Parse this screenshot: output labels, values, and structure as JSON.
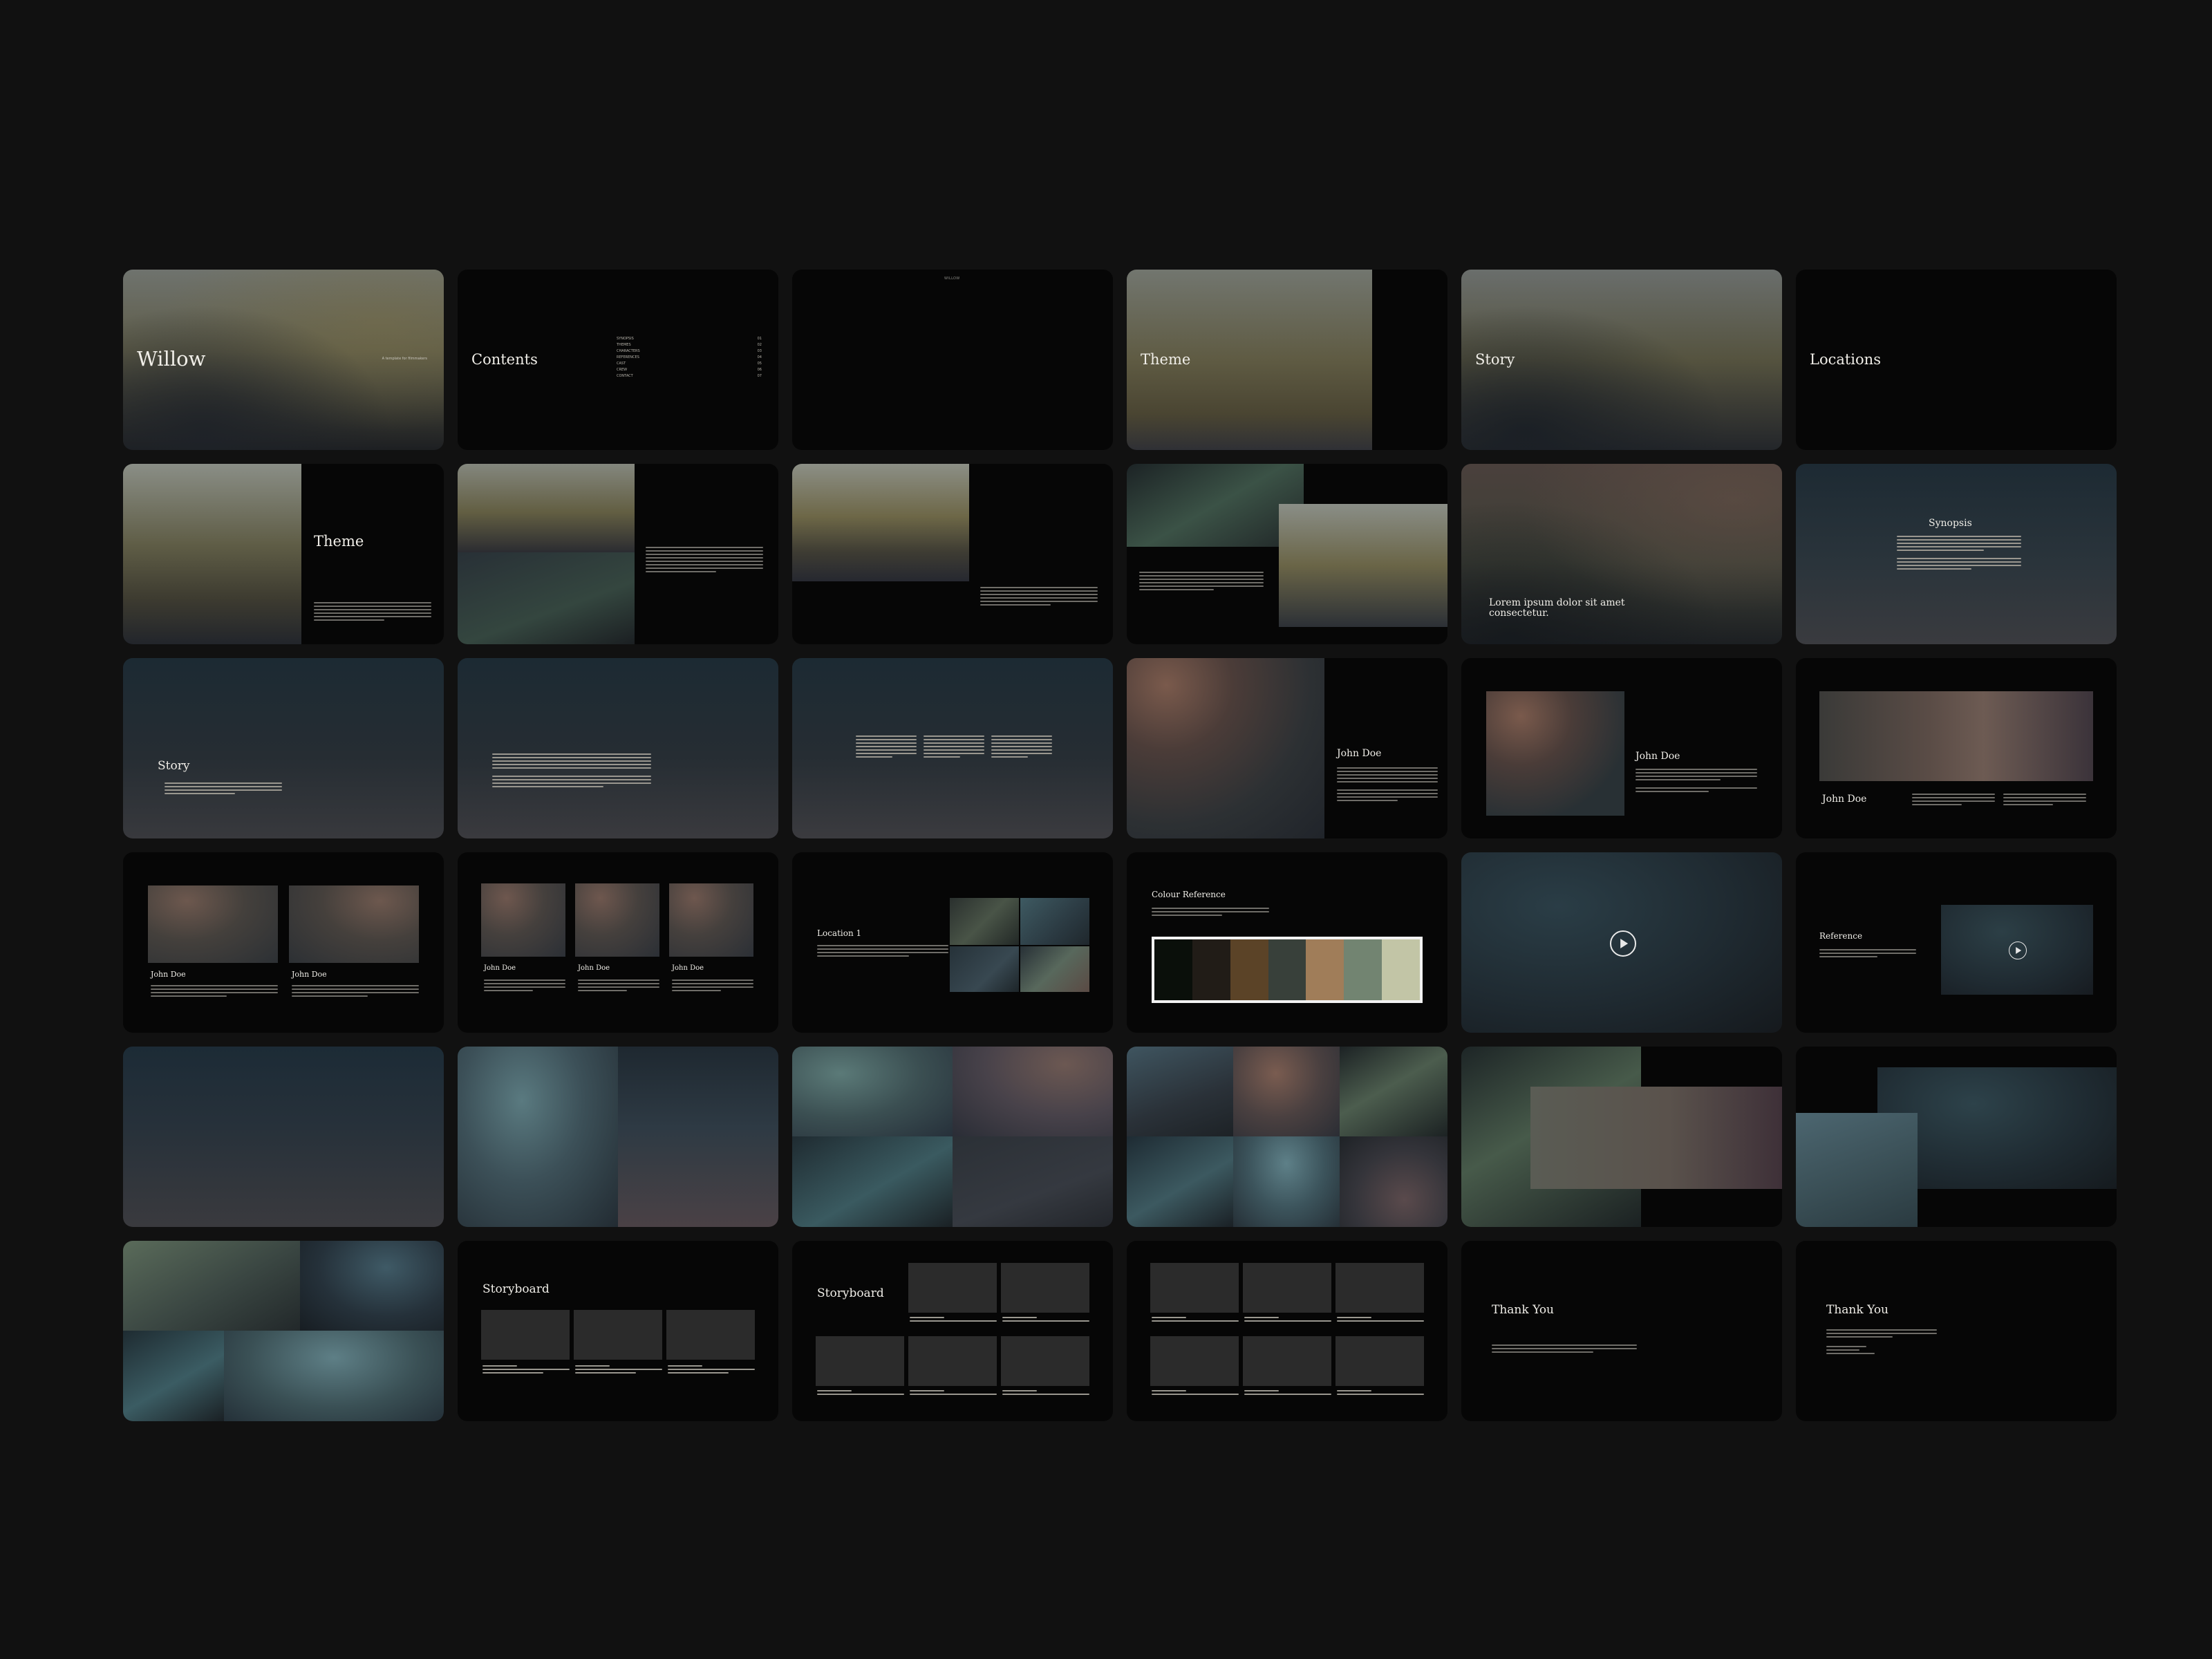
{
  "deck": {
    "title": "Willow",
    "subtitle": "A template for filmmakers",
    "header_label": "WILLOW"
  },
  "contents": {
    "heading": "Contents",
    "items": [
      {
        "label": "SYNOPSIS",
        "num": "01"
      },
      {
        "label": "THEMES",
        "num": "02"
      },
      {
        "label": "CHARACTERS",
        "num": "03"
      },
      {
        "label": "REFERENCES",
        "num": "04"
      },
      {
        "label": "CAST",
        "num": "05"
      },
      {
        "label": "CREW",
        "num": "06"
      },
      {
        "label": "CONTACT",
        "num": "07"
      }
    ]
  },
  "sections": {
    "theme": "Theme",
    "story": "Story",
    "locations": "Locations",
    "synopsis": "Synopsis",
    "quote": "Lorem ipsum dolor sit amet consectetur.",
    "character": "John Doe",
    "location_1": "Location 1",
    "colour_reference": "Colour Reference",
    "reference": "Reference",
    "storyboard": "Storyboard",
    "thank_you": "Thank You"
  },
  "colour_palette": [
    "#0a0f0a",
    "#211c17",
    "#5b4327",
    "#38403a",
    "#a07d59",
    "#728471",
    "#c2c5a6"
  ],
  "image_palette": {
    "fog": "#7e8279",
    "olive": "#6b6544",
    "dusk": "#2a3744",
    "teal": "#3d5a60",
    "rose": "#6b5048",
    "slate": "#262b33",
    "sage": "#5b6e5f"
  }
}
